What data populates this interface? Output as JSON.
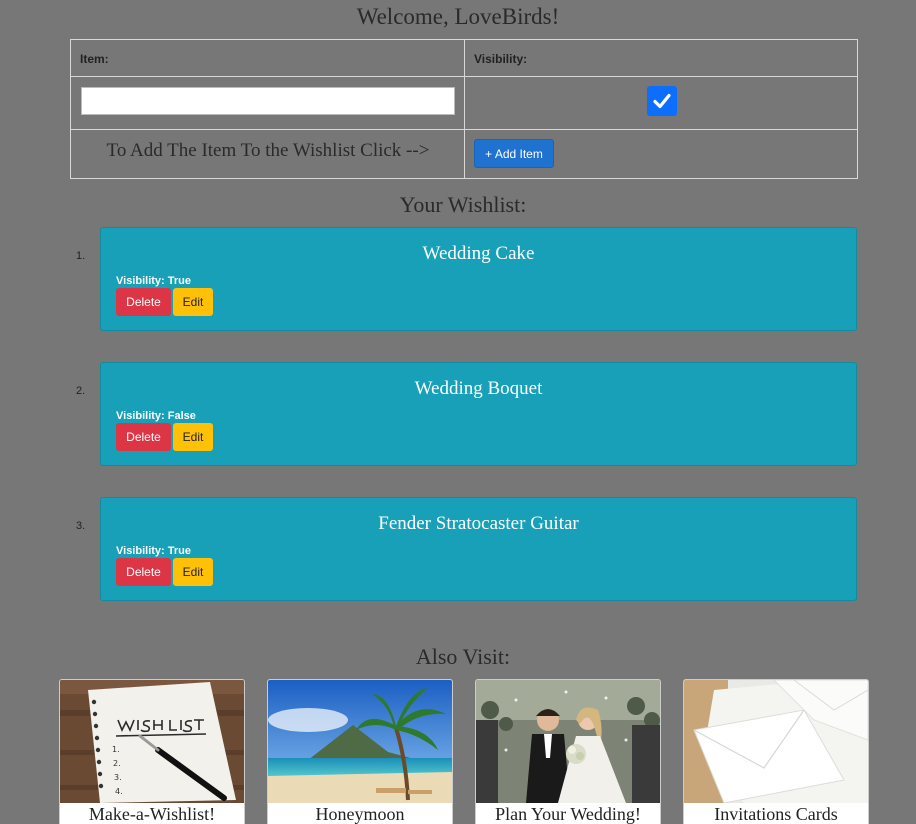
{
  "header": {
    "welcome": "Welcome, LoveBirds!"
  },
  "form": {
    "item_label": "Item:",
    "visibility_label": "Visibility:",
    "item_value": "",
    "visibility_checked": true,
    "add_instruction": "To Add The Item To the Wishlist Click -->",
    "add_button": "+ Add Item"
  },
  "wishlist": {
    "heading": "Your Wishlist:",
    "items": [
      {
        "number": "1.",
        "title": "Wedding Cake",
        "visibility": "Visibility: True",
        "delete_label": "Delete",
        "edit_label": "Edit"
      },
      {
        "number": "2.",
        "title": "Wedding Boquet",
        "visibility": "Visibility: False",
        "delete_label": "Delete",
        "edit_label": "Edit"
      },
      {
        "number": "3.",
        "title": "Fender Stratocaster Guitar",
        "visibility": "Visibility: True",
        "delete_label": "Delete",
        "edit_label": "Edit"
      }
    ]
  },
  "also_visit": {
    "heading": "Also Visit:",
    "cards": [
      {
        "label": "Make-a-Wishlist!",
        "image": "wish-list-notebook-image"
      },
      {
        "label": "Honeymoon",
        "image": "tropical-beach-image"
      },
      {
        "label": "Plan Your Wedding!",
        "image": "wedding-couple-image"
      },
      {
        "label": "Invitations Cards",
        "image": "envelopes-image"
      }
    ]
  },
  "colors": {
    "background": "#777777",
    "card": "#17a0b8",
    "primary": "#1f72d0",
    "danger": "#dc3545",
    "warning": "#ffc107"
  }
}
